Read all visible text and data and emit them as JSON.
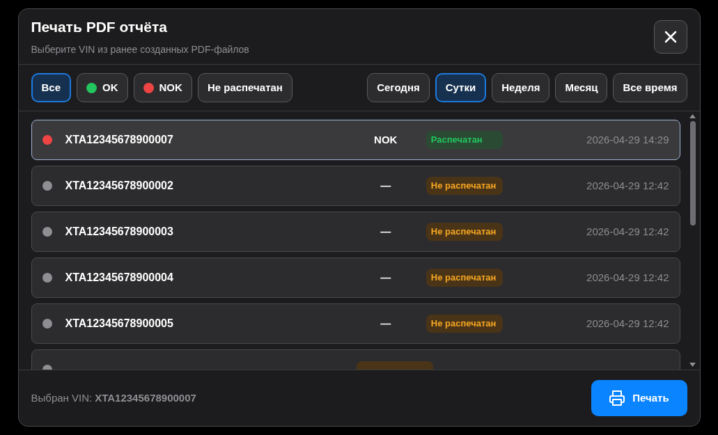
{
  "dialog": {
    "title": "Печать PDF отчёта",
    "subtitle": "Выберите VIN из ранее созданных PDF-файлов"
  },
  "status_filters": [
    {
      "label": "Все",
      "selected": true
    },
    {
      "label": "OK",
      "selected": false,
      "color": "#22c55e"
    },
    {
      "label": "NOK",
      "selected": false,
      "color": "#ef4444"
    },
    {
      "label": "Не распечатан",
      "selected": false
    }
  ],
  "period_filters": [
    {
      "label": "Сегодня",
      "selected": false
    },
    {
      "label": "Сутки",
      "selected": true
    },
    {
      "label": "Неделя",
      "selected": false
    },
    {
      "label": "Месяц",
      "selected": false
    },
    {
      "label": "Все время",
      "selected": false
    }
  ],
  "rows": [
    {
      "vin": "XTA12345678900007",
      "result": "NOK",
      "color": "#ef4444",
      "status": "Распечатан",
      "printed": true,
      "date": "2026-04-29 14:29",
      "selected": true
    },
    {
      "vin": "XTA12345678900002",
      "result": "—",
      "color": "#8e8e93",
      "status": "Не распечатан",
      "printed": false,
      "date": "2026-04-29 12:42",
      "selected": false
    },
    {
      "vin": "XTA12345678900003",
      "result": "—",
      "color": "#8e8e93",
      "status": "Не распечатан",
      "printed": false,
      "date": "2026-04-29 12:42",
      "selected": false
    },
    {
      "vin": "XTA12345678900004",
      "result": "—",
      "color": "#8e8e93",
      "status": "Не распечатан",
      "printed": false,
      "date": "2026-04-29 12:42",
      "selected": false
    },
    {
      "vin": "XTA12345678900005",
      "result": "—",
      "color": "#8e8e93",
      "status": "Не распечатан",
      "printed": false,
      "date": "2026-04-29 12:42",
      "selected": false
    },
    {
      "color": "#8e8e93",
      "printed": false,
      "selected": false
    }
  ],
  "footer": {
    "label": "Выбран VIN:",
    "vin": "XTA12345678900007",
    "print_button": "Печать"
  }
}
